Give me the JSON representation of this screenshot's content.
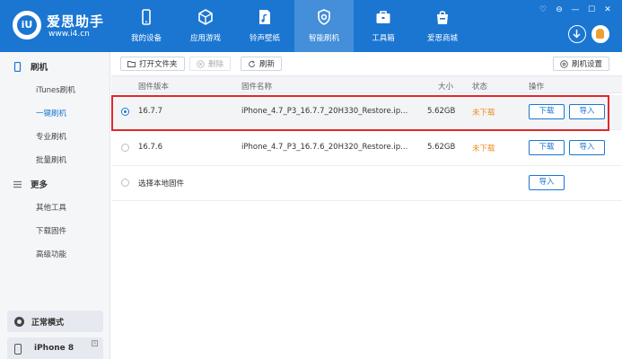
{
  "app": {
    "brand_name": "爱思助手",
    "brand_url": "www.i4.cn",
    "logo_glyph": "iU"
  },
  "nav": [
    {
      "label": "我的设备",
      "icon": "phone-icon"
    },
    {
      "label": "应用游戏",
      "icon": "apps-icon"
    },
    {
      "label": "铃声壁纸",
      "icon": "music-file-icon"
    },
    {
      "label": "智能刷机",
      "icon": "flash-gear-icon",
      "active": true
    },
    {
      "label": "工具箱",
      "icon": "toolbox-icon"
    },
    {
      "label": "爱思商城",
      "icon": "shopping-bag-icon"
    }
  ],
  "window_controls": [
    "♡",
    "⊖",
    "—",
    "☐",
    "✕"
  ],
  "sidebar": {
    "section_flash": "刷机",
    "flash_items": [
      {
        "label": "iTunes刷机"
      },
      {
        "label": "一键刷机",
        "active": true
      },
      {
        "label": "专业刷机"
      },
      {
        "label": "批量刷机"
      }
    ],
    "section_more": "更多",
    "more_items": [
      {
        "label": "其他工具"
      },
      {
        "label": "下载固件"
      },
      {
        "label": "高级功能"
      }
    ],
    "mode_label": "正常模式",
    "device_name": "iPhone 8"
  },
  "toolbar": {
    "open_folder": "打开文件夹",
    "delete": "删除",
    "refresh": "刷新",
    "flash_settings": "刷机设置"
  },
  "table": {
    "headers": {
      "version": "固件版本",
      "name": "固件名称",
      "size": "大小",
      "status": "状态",
      "action": "操作"
    },
    "rows": [
      {
        "version": "16.7.7",
        "name": "iPhone_4.7_P3_16.7.7_20H330_Restore.ip...",
        "size": "5.62GB",
        "status": "未下载",
        "download": "下载",
        "import": "导入",
        "selected": true
      },
      {
        "version": "16.7.6",
        "name": "iPhone_4.7_P3_16.7.6_20H320_Restore.ip...",
        "size": "5.62GB",
        "status": "未下载",
        "download": "下载",
        "import": "导入",
        "selected": false
      }
    ],
    "local_row": {
      "label": "选择本地固件",
      "import": "导入"
    }
  },
  "colors": {
    "brand_blue": "#1b76d2",
    "status_orange": "#f08c1c",
    "highlight_red": "#e0282c"
  }
}
